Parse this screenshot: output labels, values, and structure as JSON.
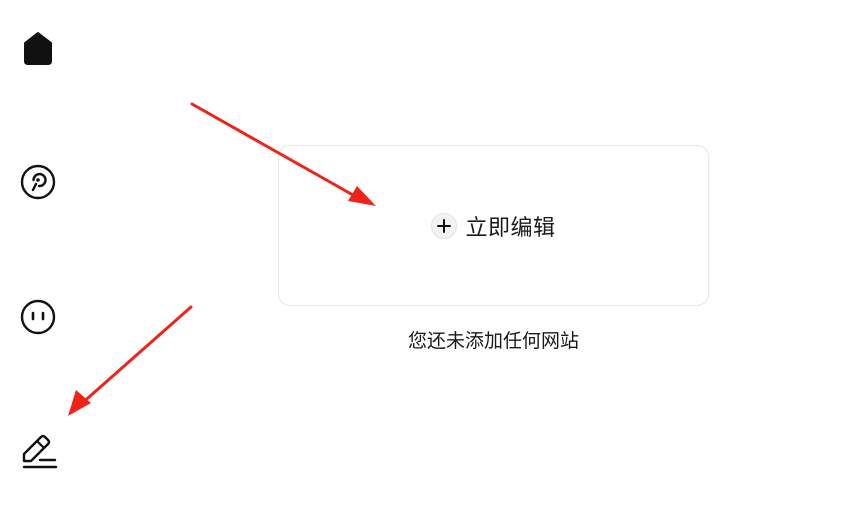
{
  "sidebar": {
    "items": [
      {
        "name": "home",
        "icon": "home-icon"
      },
      {
        "name": "discover",
        "icon": "compass-icon"
      },
      {
        "name": "chat",
        "icon": "emoji-face-icon"
      },
      {
        "name": "edit",
        "icon": "edit-pen-icon"
      }
    ]
  },
  "main": {
    "edit_button_label": "立即编辑",
    "empty_message": "您还未添加任何网站"
  },
  "colors": {
    "annotation_arrow": "#f0231b",
    "icon": "#111111",
    "card_border": "#e6e6e6"
  }
}
